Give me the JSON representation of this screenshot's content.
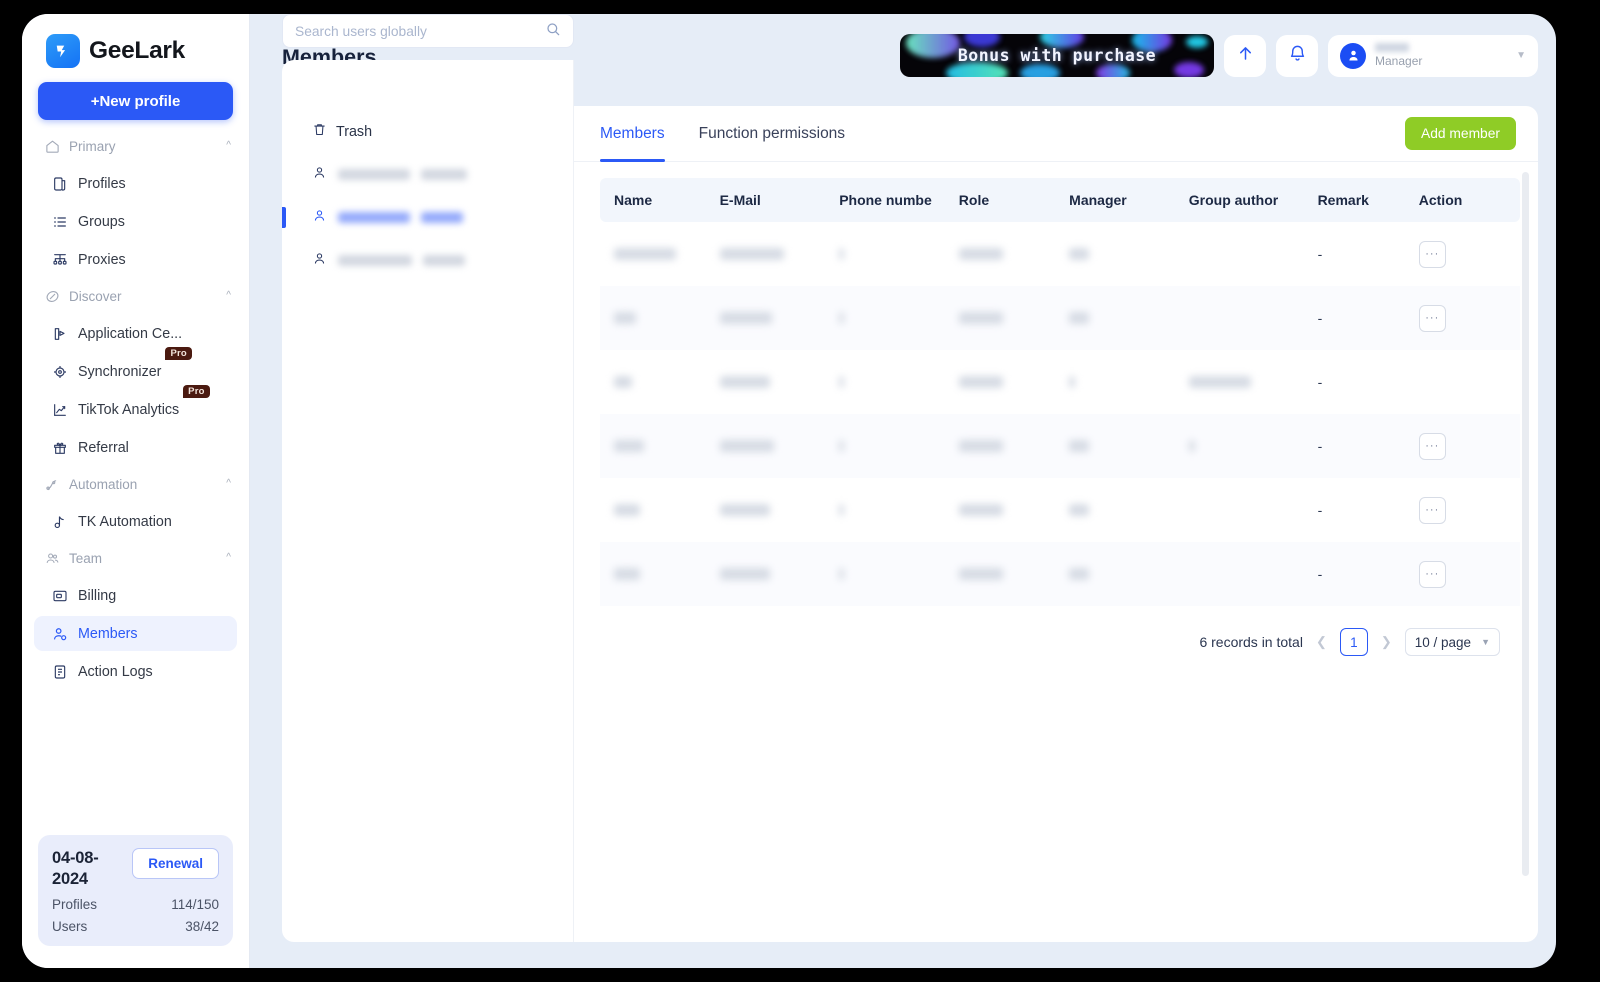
{
  "brand": {
    "name": "GeeLark",
    "logo_icon": "geelark-bird-logo"
  },
  "sidebar": {
    "new_profile_label": "+New profile",
    "groups": [
      {
        "label": "Primary",
        "icon": "home-icon",
        "items": [
          {
            "label": "Profiles",
            "icon": "profiles-icon"
          },
          {
            "label": "Groups",
            "icon": "groups-list-icon"
          },
          {
            "label": "Proxies",
            "icon": "proxies-network-icon"
          }
        ]
      },
      {
        "label": "Discover",
        "icon": "compass-icon",
        "items": [
          {
            "label": "Application Ce...",
            "icon": "application-center-icon"
          },
          {
            "label": "Synchronizer",
            "icon": "synchronizer-icon",
            "badge": "Pro"
          },
          {
            "label": "TikTok Analytics",
            "icon": "analytics-chart-icon",
            "badge": "Pro"
          },
          {
            "label": "Referral",
            "icon": "gift-icon"
          }
        ]
      },
      {
        "label": "Automation",
        "icon": "automation-icon",
        "items": [
          {
            "label": "TK Automation",
            "icon": "tiktok-note-icon"
          }
        ]
      },
      {
        "label": "Team",
        "icon": "team-people-icon",
        "items": [
          {
            "label": "Billing",
            "icon": "billing-card-icon"
          },
          {
            "label": "Members",
            "icon": "members-user-icon",
            "active": true
          },
          {
            "label": "Action Logs",
            "icon": "action-logs-icon"
          }
        ]
      }
    ],
    "plan": {
      "date": "04-08-2024",
      "renewal_label": "Renewal",
      "rows": [
        {
          "label": "Profiles",
          "value": "114/150"
        },
        {
          "label": "Users",
          "value": "38/42"
        }
      ]
    }
  },
  "header": {
    "title": "Members",
    "promo": {
      "text": "Bonus with purchase"
    },
    "upload_icon": "arrow-up-icon",
    "bell_icon": "bell-notification-icon",
    "user": {
      "avatar_icon": "user-avatar-icon",
      "name": "",
      "role": "Manager",
      "caret_icon": "chevron-down-icon"
    }
  },
  "search": {
    "placeholder": "Search users globally",
    "value": "",
    "icon": "search-icon"
  },
  "left_panel": {
    "trash": {
      "label": "Trash",
      "icon": "trash-icon"
    },
    "users": [
      {
        "icon": "user-outline-icon",
        "selected": false,
        "w1": 72,
        "w2": 46
      },
      {
        "icon": "user-outline-icon",
        "selected": true,
        "w1": 72,
        "w2": 42
      },
      {
        "icon": "user-outline-icon",
        "selected": false,
        "w1": 74,
        "w2": 42
      }
    ]
  },
  "main": {
    "tabs": [
      {
        "label": "Members",
        "active": true
      },
      {
        "label": "Function permissions",
        "active": false
      }
    ],
    "add_member_label": "Add member",
    "table": {
      "columns": [
        "Name",
        "E-Mail",
        "Phone numbe",
        "Role",
        "Manager",
        "Group author",
        "Remark",
        "Action"
      ],
      "rows": [
        {
          "name_w": 62,
          "email_w": 64,
          "phone_w": 5,
          "role_w": 44,
          "manager_w": 20,
          "group_author_w": 0,
          "remark": "-",
          "action": "···"
        },
        {
          "name_w": 22,
          "email_w": 52,
          "phone_w": 5,
          "role_w": 44,
          "manager_w": 20,
          "group_author_w": 0,
          "remark": "-",
          "action": "···"
        },
        {
          "name_w": 18,
          "email_w": 50,
          "phone_w": 5,
          "role_w": 44,
          "manager_w": 6,
          "group_author_w": 62,
          "remark": "-",
          "action": ""
        },
        {
          "name_w": 30,
          "email_w": 54,
          "phone_w": 5,
          "role_w": 44,
          "manager_w": 20,
          "group_author_w": 6,
          "remark": "-",
          "action": "···"
        },
        {
          "name_w": 26,
          "email_w": 50,
          "phone_w": 5,
          "role_w": 44,
          "manager_w": 20,
          "group_author_w": 0,
          "remark": "-",
          "action": "···"
        },
        {
          "name_w": 26,
          "email_w": 50,
          "phone_w": 5,
          "role_w": 44,
          "manager_w": 20,
          "group_author_w": 0,
          "remark": "-",
          "action": "···"
        }
      ]
    },
    "pagination": {
      "total_label": "6 records in total",
      "prev_icon": "chevron-left-icon",
      "next_icon": "chevron-right-icon",
      "current_page": "1",
      "page_size": "10 / page",
      "page_size_caret": "chevron-down-icon"
    }
  },
  "colors": {
    "accent_blue": "#2b59f6",
    "add_member_green": "#8fcc26",
    "pro_badge_bg": "#4b1a10",
    "page_bg": "#e6edf7"
  }
}
